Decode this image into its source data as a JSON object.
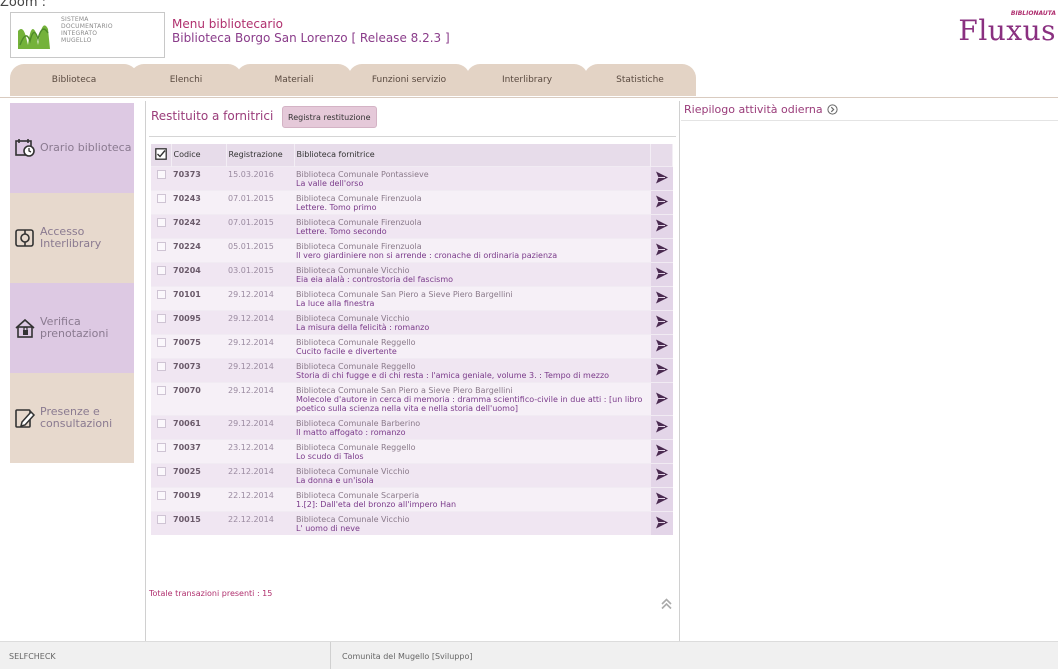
{
  "top_cut_text": "Zoom : ",
  "logo": {
    "lines": [
      "SISTEMA",
      "DOCUMENTARIO",
      "INTEGRATO",
      "MUGELLO"
    ]
  },
  "header": {
    "menu_title": "Menu bibliotecario",
    "subtitle": "Biblioteca Borgo San Lorenzo [ Release 8.2.3 ]",
    "brand": "Fluxus",
    "brand_small": "BIBLIONAUTA"
  },
  "tabs": [
    {
      "label": "Biblioteca"
    },
    {
      "label": "Elenchi"
    },
    {
      "label": "Materiali"
    },
    {
      "label": "Funzioni servizio"
    },
    {
      "label": "Interlibrary"
    },
    {
      "label": "Statistiche"
    }
  ],
  "sidebar": {
    "items": [
      {
        "label": "Orario biblioteca",
        "icon": "calendar-clock-icon",
        "bg": "#ddc9e3"
      },
      {
        "label": "Accesso Interlibrary",
        "icon": "interlibrary-icon",
        "bg": "#e7d9cd"
      },
      {
        "label": "Verifica prenotazioni",
        "icon": "house-lock-icon",
        "bg": "#ddc9e3"
      },
      {
        "label": "Presenze e consultazioni",
        "icon": "edit-note-icon",
        "bg": "#e7d9cd"
      }
    ]
  },
  "main": {
    "title": "Restituito a fornitrici",
    "register_button": "Registra restituzione",
    "columns": {
      "code": "Codice",
      "date": "Registrazione",
      "library": "Biblioteca fornitrice"
    },
    "rows": [
      {
        "code": "70373",
        "date": "15.03.2016",
        "library": "Biblioteca Comunale Pontassieve",
        "title": "La valle dell'orso"
      },
      {
        "code": "70243",
        "date": "07.01.2015",
        "library": "Biblioteca Comunale Firenzuola",
        "title": "Lettere. Tomo primo"
      },
      {
        "code": "70242",
        "date": "07.01.2015",
        "library": "Biblioteca Comunale Firenzuola",
        "title": "Lettere. Tomo secondo"
      },
      {
        "code": "70224",
        "date": "05.01.2015",
        "library": "Biblioteca Comunale Firenzuola",
        "title": "Il vero giardiniere non si arrende : cronache di ordinaria pazienza"
      },
      {
        "code": "70204",
        "date": "03.01.2015",
        "library": "Biblioteca Comunale Vicchio",
        "title": "Eia eia alalà : controstoria del fascismo"
      },
      {
        "code": "70101",
        "date": "29.12.2014",
        "library": "Biblioteca Comunale San Piero a Sieve Piero Bargellini",
        "title": "La luce alla finestra"
      },
      {
        "code": "70095",
        "date": "29.12.2014",
        "library": "Biblioteca Comunale Vicchio",
        "title": "La misura della felicità : romanzo"
      },
      {
        "code": "70075",
        "date": "29.12.2014",
        "library": "Biblioteca Comunale Reggello",
        "title": "Cucito facile e divertente"
      },
      {
        "code": "70073",
        "date": "29.12.2014",
        "library": "Biblioteca Comunale Reggello",
        "title": "Storia di chi fugge e di chi resta : l'amica geniale, volume 3. : Tempo di mezzo"
      },
      {
        "code": "70070",
        "date": "29.12.2014",
        "library": "Biblioteca Comunale San Piero a Sieve Piero Bargellini",
        "title": "Molecole d'autore in cerca di memoria : dramma scientifico-civile in due atti : [un libro poetico sulla scienza nella vita e nella storia dell'uomo]"
      },
      {
        "code": "70061",
        "date": "29.12.2014",
        "library": "Biblioteca Comunale Barberino",
        "title": "Il matto affogato : romanzo"
      },
      {
        "code": "70037",
        "date": "23.12.2014",
        "library": "Biblioteca Comunale Reggello",
        "title": "Lo scudo di Talos"
      },
      {
        "code": "70025",
        "date": "22.12.2014",
        "library": "Biblioteca Comunale Vicchio",
        "title": "La donna e un'isola"
      },
      {
        "code": "70019",
        "date": "22.12.2014",
        "library": "Biblioteca Comunale Scarperia",
        "title": "1.[2]: Dall'eta del bronzo all'impero Han"
      },
      {
        "code": "70015",
        "date": "22.12.2014",
        "library": "Biblioteca Comunale Vicchio",
        "title": "L' uomo di neve"
      }
    ],
    "total_text": "Totale transazioni presenti : 15"
  },
  "right": {
    "title": "Riepilogo attività odierna"
  },
  "footer": {
    "left": "SELFCHECK",
    "center": "Comunita del Mugello [Sviluppo]"
  },
  "colors": {
    "accent": "#9a3c7a",
    "tab_bg": "#e3d3c5",
    "row_odd": "#f0e6f2",
    "row_even": "#f6f0f7"
  }
}
